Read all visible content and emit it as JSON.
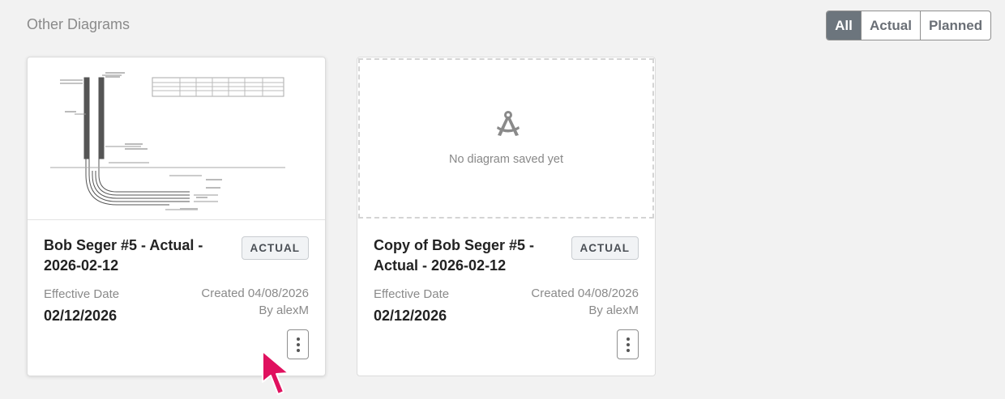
{
  "section": {
    "title": "Other Diagrams"
  },
  "filters": [
    {
      "label": "All",
      "active": true
    },
    {
      "label": "Actual",
      "active": false
    },
    {
      "label": "Planned",
      "active": false
    }
  ],
  "cards": [
    {
      "title": "Bob Seger #5 - Actual - 2026-02-12",
      "badge": "ACTUAL",
      "effective_label": "Effective Date",
      "effective_date": "02/12/2026",
      "created": "Created 04/08/2026",
      "created_by": "By alexM",
      "has_diagram": true
    },
    {
      "title": "Copy of Bob Seger #5 - Actual - 2026-02-12",
      "badge": "ACTUAL",
      "effective_label": "Effective Date",
      "effective_date": "02/12/2026",
      "created": "Created 04/08/2026",
      "created_by": "By alexM",
      "has_diagram": false,
      "placeholder_text": "No diagram saved yet"
    }
  ],
  "colors": {
    "accent": "#6c757d",
    "cursor": "#e0115f"
  },
  "icons": {
    "placeholder": "drafting-compass-icon",
    "menu": "kebab-menu-icon",
    "cursor": "mouse-pointer-icon"
  }
}
